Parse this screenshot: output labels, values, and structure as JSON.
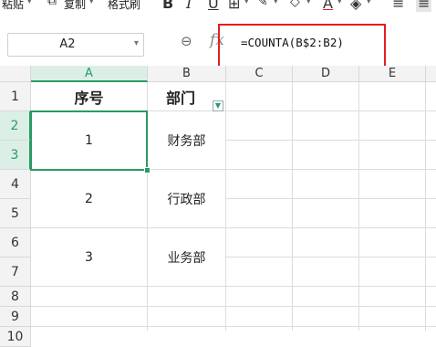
{
  "toolbar": {
    "paste_label": "粘贴",
    "copy_label": "复制",
    "format_painter_label": "格式刷",
    "bold_label": "B",
    "italic_label": "I",
    "underline_label": "U",
    "font_color_label": "A"
  },
  "formula_bar": {
    "name_box": "A2",
    "fx_label": "fx",
    "formula": "=COUNTA(B$2:B2)"
  },
  "columns": [
    "A",
    "B",
    "C",
    "D",
    "E"
  ],
  "rows": [
    "1",
    "2",
    "3",
    "4",
    "5",
    "6",
    "7",
    "8",
    "9",
    "10"
  ],
  "cells": {
    "header_seq": "序号",
    "header_dept": "部门",
    "seq_1": "1",
    "seq_2": "2",
    "seq_3": "3",
    "dept_1": "财务部",
    "dept_2": "行政部",
    "dept_3": "业务部"
  },
  "colors": {
    "selection": "#2a9a63",
    "highlight": "#e02020"
  }
}
